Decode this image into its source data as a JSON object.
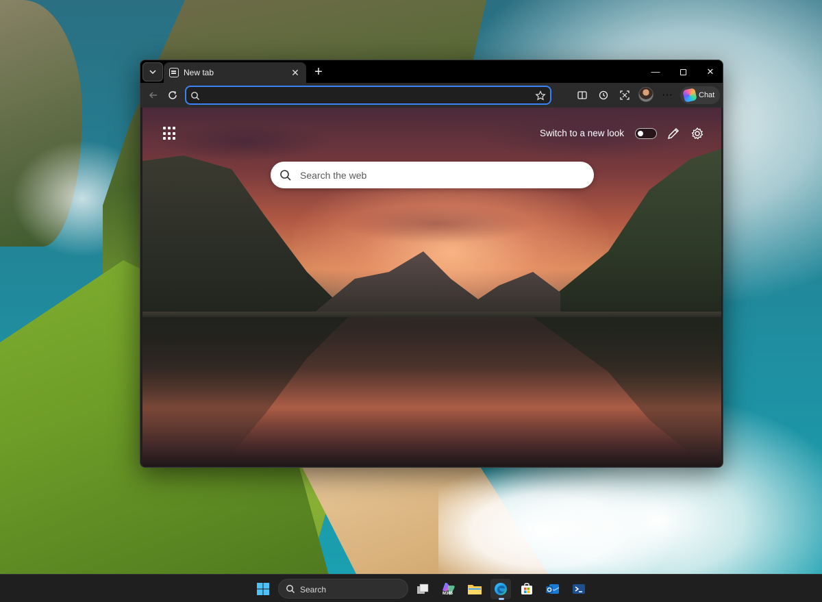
{
  "browser": {
    "tab": {
      "title": "New tab",
      "close_glyph": "✕"
    },
    "new_tab_glyph": "+",
    "window_controls": {
      "minimize_glyph": "—",
      "close_glyph": "✕"
    },
    "address_bar": {
      "value": "",
      "placeholder": ""
    },
    "more_glyph": "···",
    "chat_label": "Chat"
  },
  "new_tab_page": {
    "switch_label": "Switch to a new look",
    "switch_on": false,
    "search_placeholder": "Search the web"
  },
  "taskbar": {
    "search_label": "Search",
    "apps": [
      "start",
      "search",
      "task-view",
      "microsoft-365",
      "file-explorer",
      "edge",
      "microsoft-store",
      "outlook",
      "terminal"
    ],
    "active_app": "edge",
    "m365_label": "M365"
  },
  "colors": {
    "address_focus": "#3b82f6",
    "tab_bg": "#2b2b2b",
    "titlebar_bg": "#000000",
    "taskbar_bg": "#1f1f1f"
  }
}
